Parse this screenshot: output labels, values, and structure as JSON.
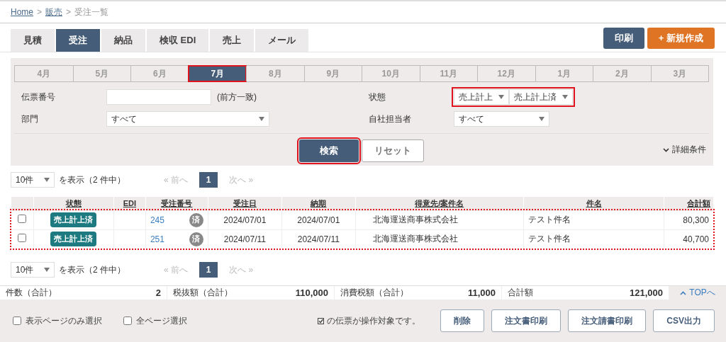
{
  "breadcrumb": [
    {
      "label": "Home",
      "link": true
    },
    {
      "label": "販売",
      "link": true
    },
    {
      "label": "受注一覧",
      "link": false
    }
  ],
  "breadcrumb_separator": ">",
  "tabs": [
    {
      "label": "見積",
      "selected": false
    },
    {
      "label": "受注",
      "selected": true
    },
    {
      "label": "納品",
      "selected": false
    },
    {
      "label": "検収 EDI",
      "selected": false
    },
    {
      "label": "売上",
      "selected": false
    },
    {
      "label": "メール",
      "selected": false
    }
  ],
  "header_buttons": [
    {
      "label": "印刷",
      "kind": "dark"
    },
    {
      "label": "+ 新規作成",
      "kind": "orange"
    }
  ],
  "months": [
    {
      "label": "4月",
      "selected": false
    },
    {
      "label": "5月",
      "selected": false
    },
    {
      "label": "6月",
      "selected": false
    },
    {
      "label": "7月",
      "selected": true,
      "highlighted": true
    },
    {
      "label": "8月",
      "selected": false
    },
    {
      "label": "9月",
      "selected": false
    },
    {
      "label": "10月",
      "selected": false
    },
    {
      "label": "11月",
      "selected": false
    },
    {
      "label": "12月",
      "selected": false
    },
    {
      "label": "1月",
      "selected": false
    },
    {
      "label": "2月",
      "selected": false
    },
    {
      "label": "3月",
      "selected": false
    }
  ],
  "filters": {
    "slip_number": {
      "label": "伝票番号",
      "note": "(前方一致)"
    },
    "department": {
      "label": "部門",
      "value": "すべて"
    },
    "status": {
      "label": "状態",
      "values": [
        "売上計上",
        "売上計上済"
      ],
      "highlighted": true
    },
    "staff": {
      "label": "自社担当者",
      "value": "すべて"
    }
  },
  "search_button": {
    "label": "検索",
    "highlighted": true
  },
  "reset_button": {
    "label": "リセット"
  },
  "advanced_toggle": "詳細条件",
  "pager_top": {
    "per_page": "10件",
    "summary": "を表示（2 件中）",
    "prev": "前へ",
    "prev_mark": "«",
    "page": "1",
    "next": "次へ",
    "next_mark": "»"
  },
  "table": {
    "columns": [
      "状態",
      "EDI",
      "受注番号",
      "受注日",
      "納期",
      "得意先/案件名",
      "件名",
      "合計額"
    ],
    "rows_highlighted": true,
    "rows": [
      {
        "checked": false,
        "status": "売上計上済",
        "number": "245",
        "done": "済",
        "order_date": "2024/07/01",
        "due_date": "2024/07/01",
        "customer": "北海運送商事株式会社",
        "subject": "テスト件名",
        "amount": "80,300"
      },
      {
        "checked": false,
        "status": "売上計上済",
        "number": "251",
        "done": "済",
        "order_date": "2024/07/11",
        "due_date": "2024/07/11",
        "customer": "北海運送商事株式会社",
        "subject": "テスト件名",
        "amount": "40,700"
      }
    ]
  },
  "pager_bottom": {
    "per_page": "10件",
    "summary": "を表示（2 件中）",
    "prev": "前へ",
    "prev_mark": "«",
    "page": "1",
    "next": "次へ",
    "next_mark": "»"
  },
  "totals": [
    {
      "label": "件数（合計）",
      "value": "2"
    },
    {
      "label": "税抜額（合計）",
      "value": "110,000"
    },
    {
      "label": "消費税額（合計）",
      "value": "11,000"
    },
    {
      "label": "合計額",
      "value": "121,000"
    }
  ],
  "top_link": "TOPへ",
  "footer": {
    "select_page": {
      "label": "表示ページのみ選択",
      "checked": false
    },
    "select_all": {
      "label": "全ページ選択",
      "checked": false
    },
    "target_note": "の伝票が操作対象です。",
    "buttons": [
      "削除",
      "注文書印刷",
      "注文請書印刷",
      "CSV出力"
    ]
  }
}
